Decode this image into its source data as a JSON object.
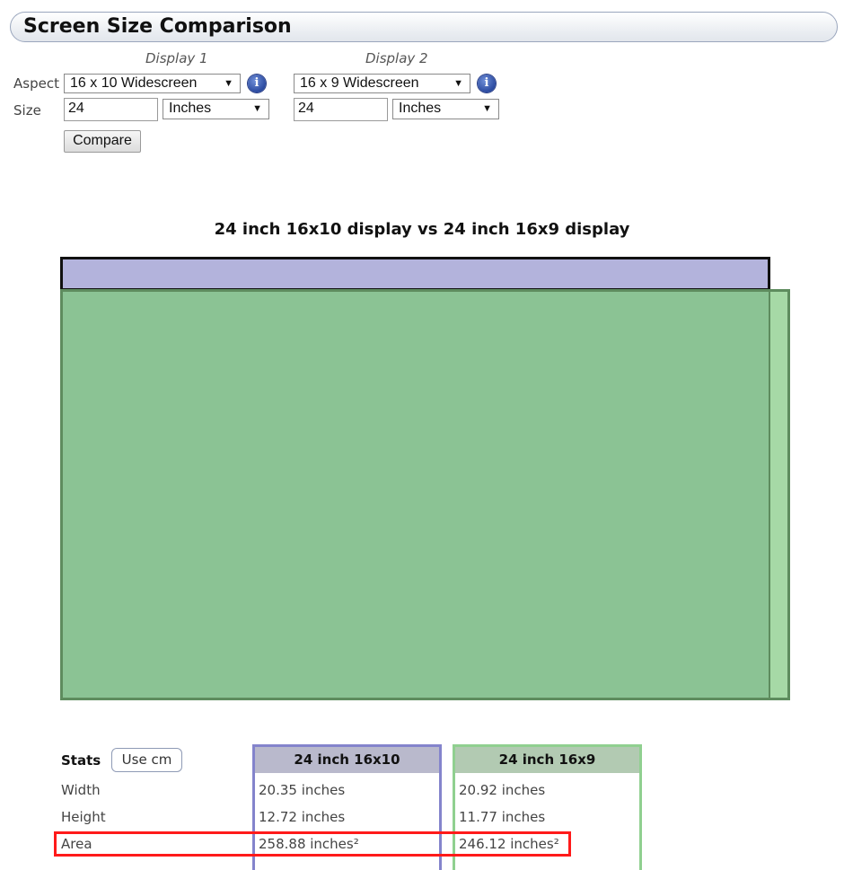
{
  "header": {
    "title": "Screen Size Comparison"
  },
  "form": {
    "display1_heading": "Display 1",
    "display2_heading": "Display 2",
    "aspect_label": "Aspect",
    "size_label": "Size",
    "display1": {
      "aspect": "16 x 10 Widescreen",
      "size": "24",
      "unit": "Inches"
    },
    "display2": {
      "aspect": "16 x 9 Widescreen",
      "size": "24",
      "unit": "Inches"
    },
    "compare_button": "Compare",
    "info_glyph": "i"
  },
  "comparison": {
    "title": "24 inch 16x10 display vs 24 inch 16x9 display",
    "display1_color": "#b3b3dc",
    "display2_color": "#a6d9a6",
    "overlap_color": "#8bc394"
  },
  "stats": {
    "label": "Stats",
    "unit_toggle": "Use cm",
    "columns": [
      {
        "title": "24 inch 16x10",
        "width": "20.35 inches",
        "height": "12.72 inches",
        "area": "258.88 inches²"
      },
      {
        "title": "24 inch 16x9",
        "width": "20.92 inches",
        "height": "11.77 inches",
        "area": "246.12 inches²"
      }
    ],
    "rows": {
      "width": "Width",
      "height": "Height",
      "area": "Area"
    },
    "highlight_color": "#ff1a1a"
  }
}
